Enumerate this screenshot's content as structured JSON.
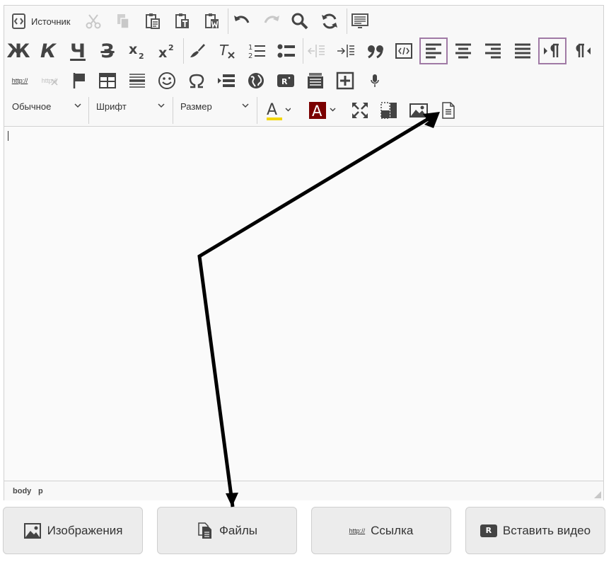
{
  "toolbar": {
    "source_label": "Источник",
    "bold_glyph": "Ж",
    "italic_glyph": "К",
    "underline_glyph": "Ч",
    "strike_glyph": "З",
    "link_text": "http://",
    "unlink_text": "http://"
  },
  "combos": {
    "format": "Обычное",
    "font": "Шрифт",
    "size": "Размер"
  },
  "path": [
    "body",
    "p"
  ],
  "buttons": {
    "images": "Изображения",
    "files": "Файлы",
    "link": "Ссылка",
    "link_icon_text": "http://",
    "video": "Вставить видео",
    "video_icon_text": "R"
  },
  "colors": {
    "text_color_bar": "#f2d600",
    "bg_color_box": "#7a0000",
    "active_border": "#a07aa5"
  }
}
